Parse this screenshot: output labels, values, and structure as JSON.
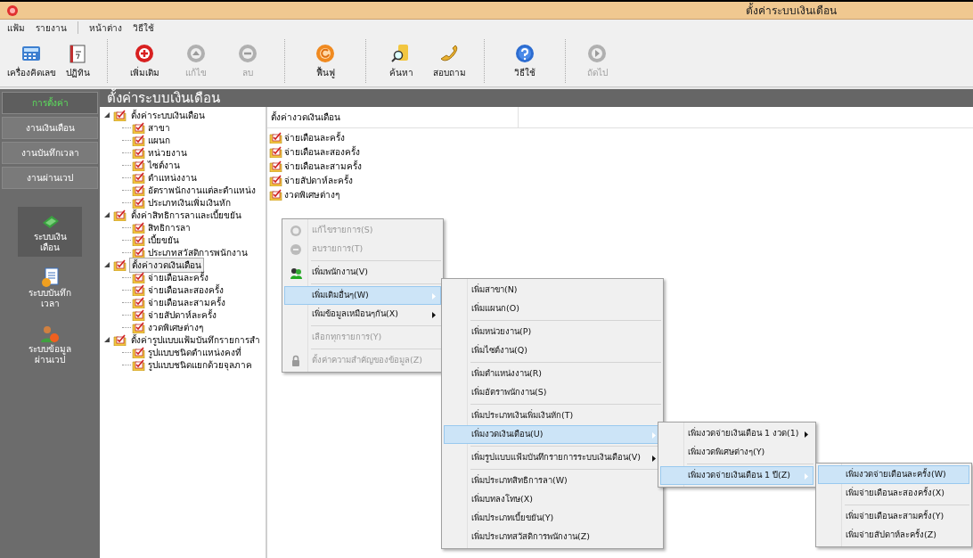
{
  "window": {
    "title": "ตั้งค่าระบบเงินเดือน"
  },
  "menu_bar": [
    {
      "label": "แฟ้ม"
    },
    {
      "label": "รายงาน"
    },
    {
      "label": "หน้าต่าง"
    },
    {
      "label": "วิธีใช้"
    }
  ],
  "toolbar": [
    {
      "label": "เครื่องคิดเลข",
      "disabled": false
    },
    {
      "label": "ปฏิทิน",
      "disabled": false
    },
    {
      "label": "เพิ่มเติม",
      "disabled": false
    },
    {
      "label": "แก้ไข",
      "disabled": true
    },
    {
      "label": "ลบ",
      "disabled": true
    },
    {
      "label": "ฟื้นฟู",
      "disabled": false
    },
    {
      "label": "ค้นหา",
      "disabled": false
    },
    {
      "label": "สอบถาม",
      "disabled": false
    },
    {
      "label": "วิธีใช้",
      "disabled": false
    },
    {
      "label": "ถัดไป",
      "disabled": true
    }
  ],
  "sidebar": {
    "tabs": [
      {
        "label": "การตั้งค่า",
        "selected": true
      },
      {
        "label": "งานเงินเดือน",
        "selected": false
      },
      {
        "label": "งานบันทึกเวลา",
        "selected": false
      },
      {
        "label": "งานผ่านเวป",
        "selected": false
      }
    ],
    "modules": [
      {
        "label": "ระบบเงิน\nเดือน",
        "selected": true
      },
      {
        "label": "ระบบบันทึก\nเวลา",
        "selected": false
      },
      {
        "label": "ระบบข้อมูล\nผ่านเวป",
        "selected": false
      }
    ]
  },
  "header": "ตั้งค่าระบบเงินเดือน",
  "tree": [
    {
      "label": "ตั้งค่าระบบเงินเดือน",
      "expanded": true,
      "selected": false,
      "children": [
        {
          "label": "สาขา"
        },
        {
          "label": "แผนก"
        },
        {
          "label": "หน่วยงาน"
        },
        {
          "label": "ไซต์งาน"
        },
        {
          "label": "ตำแหน่งงาน"
        },
        {
          "label": "อัตราพนักงานแต่ละตำแหน่ง"
        },
        {
          "label": "ประเภทเงินเพิ่มเงินหัก"
        }
      ]
    },
    {
      "label": "ตั้งค่าสิทธิการลาและเบี้ยขยัน",
      "expanded": true,
      "selected": false,
      "children": [
        {
          "label": "สิทธิการลา"
        },
        {
          "label": "เบี้ยขยัน"
        },
        {
          "label": "ประเภทสวัสดิการพนักงาน"
        }
      ]
    },
    {
      "label": "ตั้งค่างวดเงินเดือน",
      "expanded": true,
      "selected": true,
      "children": [
        {
          "label": "จ่ายเดือนละครั้ง"
        },
        {
          "label": "จ่ายเดือนละสองครั้ง"
        },
        {
          "label": "จ่ายเดือนละสามครั้ง"
        },
        {
          "label": "จ่ายสัปดาห์ละครั้ง"
        },
        {
          "label": "งวดพิเศษต่างๆ"
        }
      ]
    },
    {
      "label": "ตั้งค่ารูปแบบแฟ้มบันทึกรายการสำ",
      "expanded": true,
      "selected": false,
      "children": [
        {
          "label": "รูปแบบชนิดตำแหน่งคงที่"
        },
        {
          "label": "รูปแบบชนิดแยกด้วยจุลภาค"
        }
      ]
    }
  ],
  "list_panel": {
    "column_header": "ตั้งค่างวดเงินเดือน",
    "items": [
      {
        "label": "จ่ายเดือนละครั้ง"
      },
      {
        "label": "จ่ายเดือนละสองครั้ง"
      },
      {
        "label": "จ่ายเดือนละสามครั้ง"
      },
      {
        "label": "จ่ายสัปดาห์ละครั้ง"
      },
      {
        "label": "งวดพิเศษต่างๆ"
      }
    ]
  },
  "context_menus": [
    {
      "items": [
        {
          "kind": "item",
          "label": "แก้ไขรายการ(S)",
          "disabled": true,
          "selected": false,
          "submenu": false
        },
        {
          "kind": "item",
          "label": "ลบรายการ(T)",
          "disabled": true,
          "selected": false,
          "submenu": false
        },
        {
          "kind": "separator"
        },
        {
          "kind": "item",
          "label": "เพิ่มพนักงาน(V)",
          "disabled": false,
          "selected": false,
          "submenu": false
        },
        {
          "kind": "separator"
        },
        {
          "kind": "item",
          "label": "เพิ่มเติมอื่นๆ(W)",
          "disabled": false,
          "selected": true,
          "submenu": true
        },
        {
          "kind": "item",
          "label": "เพิ่มข้อมูลเหมือนๆกัน(X)",
          "disabled": false,
          "selected": false,
          "submenu": true
        },
        {
          "kind": "separator"
        },
        {
          "kind": "item",
          "label": "เลือกทุกรายการ(Y)",
          "disabled": true,
          "selected": false,
          "submenu": false
        },
        {
          "kind": "separator"
        },
        {
          "kind": "item",
          "label": "ตั้งค่าความสำคัญของข้อมูล(Z)",
          "disabled": true,
          "selected": false,
          "submenu": false
        }
      ]
    },
    {
      "items": [
        {
          "kind": "item",
          "label": "เพิ่มสาขา(N)",
          "disabled": false,
          "selected": false,
          "submenu": false
        },
        {
          "kind": "item",
          "label": "เพิ่มแผนก(O)",
          "disabled": false,
          "selected": false,
          "submenu": false
        },
        {
          "kind": "separator"
        },
        {
          "kind": "item",
          "label": "เพิ่มหน่วยงาน(P)",
          "disabled": false,
          "selected": false,
          "submenu": false
        },
        {
          "kind": "item",
          "label": "เพิ่มไซต์งาน(Q)",
          "disabled": false,
          "selected": false,
          "submenu": false
        },
        {
          "kind": "separator"
        },
        {
          "kind": "item",
          "label": "เพิ่มตำแหน่งงาน(R)",
          "disabled": false,
          "selected": false,
          "submenu": false
        },
        {
          "kind": "item",
          "label": "เพิ่มอัตราพนักงาน(S)",
          "disabled": false,
          "selected": false,
          "submenu": false
        },
        {
          "kind": "separator"
        },
        {
          "kind": "item",
          "label": "เพิ่มประเภทเงินเพิ่มเงินหัก(T)",
          "disabled": false,
          "selected": false,
          "submenu": false
        },
        {
          "kind": "item",
          "label": "เพิ่มงวดเงินเดือน(U)",
          "disabled": false,
          "selected": true,
          "submenu": true
        },
        {
          "kind": "separator"
        },
        {
          "kind": "item",
          "label": "เพิ่มรูปแบบแฟ้มบันทึกรายการระบบเงินเดือน(V)",
          "disabled": false,
          "selected": false,
          "submenu": true
        },
        {
          "kind": "separator"
        },
        {
          "kind": "item",
          "label": "เพิ่มประเภทสิทธิการลา(W)",
          "disabled": false,
          "selected": false,
          "submenu": false
        },
        {
          "kind": "item",
          "label": "เพิ่มบทลงโทษ(X)",
          "disabled": false,
          "selected": false,
          "submenu": false
        },
        {
          "kind": "item",
          "label": "เพิ่มประเภทเบี้ยขยัน(Y)",
          "disabled": false,
          "selected": false,
          "submenu": false
        },
        {
          "kind": "item",
          "label": "เพิ่มประเภทสวัสดิการพนักงาน(Z)",
          "disabled": false,
          "selected": false,
          "submenu": false
        }
      ]
    },
    {
      "items": [
        {
          "kind": "item",
          "label": "เพิ่มงวดจ่ายเงินเดือน 1 งวด(1)",
          "disabled": false,
          "selected": false,
          "submenu": true
        },
        {
          "kind": "item",
          "label": "เพิ่มงวดพิเศษต่างๆ(Y)",
          "disabled": false,
          "selected": false,
          "submenu": false
        },
        {
          "kind": "separator"
        },
        {
          "kind": "item",
          "label": "เพิ่มงวดจ่ายเงินเดือน 1 ปี(Z)",
          "disabled": false,
          "selected": true,
          "submenu": true
        }
      ]
    },
    {
      "items": [
        {
          "kind": "item",
          "label": "เพิ่มงวดจ่ายเดือนละครั้ง(W)",
          "disabled": false,
          "selected": true,
          "submenu": false
        },
        {
          "kind": "item",
          "label": "เพิ่มจ่ายเดือนละสองครั้ง(X)",
          "disabled": false,
          "selected": false,
          "submenu": false
        },
        {
          "kind": "separator"
        },
        {
          "kind": "item",
          "label": "เพิ่มจ่ายเดือนละสามครั้ง(Y)",
          "disabled": false,
          "selected": false,
          "submenu": false
        },
        {
          "kind": "item",
          "label": "เพิ่มจ่ายสัปดาห์ละครั้ง(Z)",
          "disabled": false,
          "selected": false,
          "submenu": false
        }
      ]
    }
  ]
}
